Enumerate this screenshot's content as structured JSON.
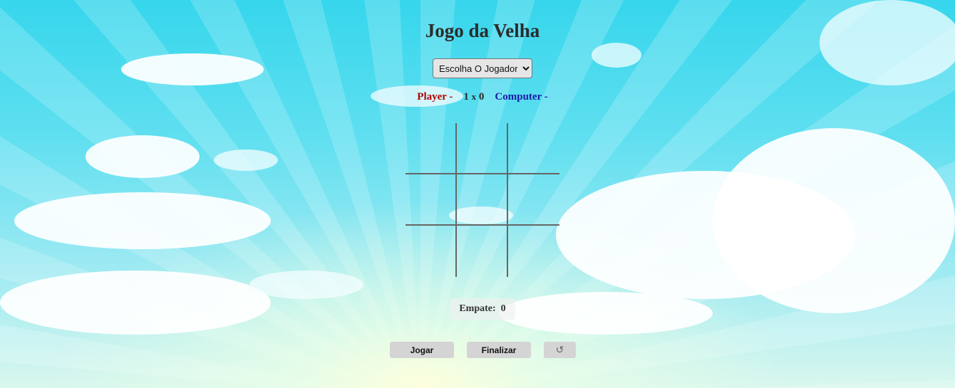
{
  "title": "Jogo da Velha",
  "player_select": {
    "selected": "Escolha O Jogador",
    "options": [
      "Escolha O Jogador"
    ]
  },
  "scoreboard": {
    "player_label": "Player -",
    "player_score": "1",
    "separator": "x",
    "computer_score": "0",
    "computer_label": "Computer -"
  },
  "board": {
    "cells": [
      "",
      "",
      "",
      "",
      "",
      "",
      "",
      "",
      ""
    ]
  },
  "tie": {
    "label": "Empate:",
    "count": "0"
  },
  "buttons": {
    "play": "Jogar",
    "finish": "Finalizar",
    "reset_icon": "↺"
  },
  "colors": {
    "player": "#b00000",
    "computer": "#1a1aa8",
    "grid": "#666666",
    "button": "#d4d4d4"
  },
  "icons": {
    "reset": "refresh-icon"
  }
}
